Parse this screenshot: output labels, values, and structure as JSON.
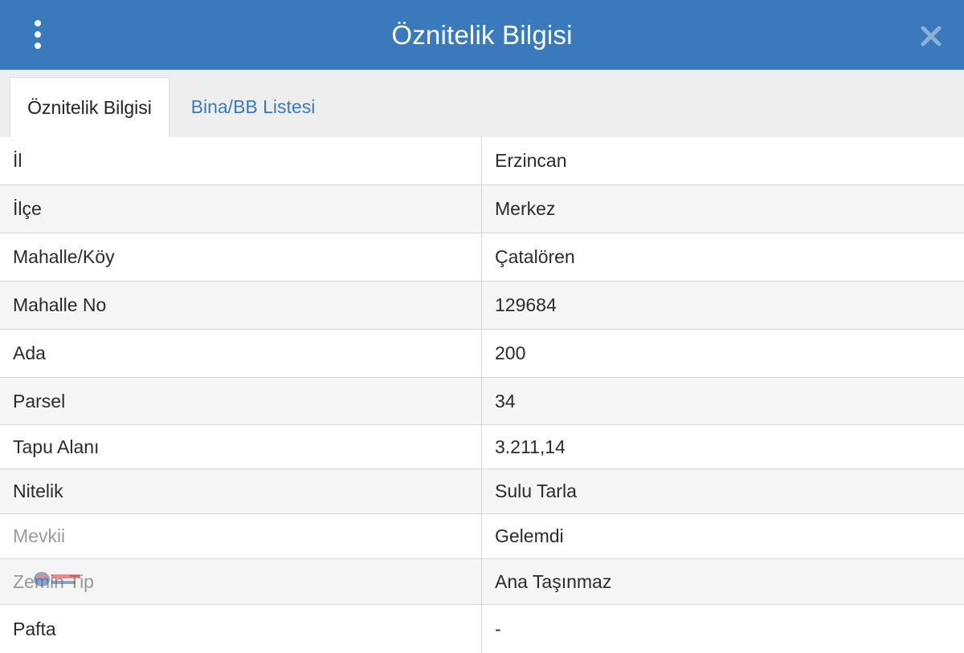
{
  "header": {
    "title": "Öznitelik Bilgisi"
  },
  "tabs": [
    {
      "label": "Öznitelik Bilgisi",
      "active": true
    },
    {
      "label": "Bina/BB Listesi",
      "active": false
    }
  ],
  "rows": [
    {
      "label": "İl",
      "value": "Erzincan"
    },
    {
      "label": "İlçe",
      "value": "Merkez"
    },
    {
      "label": "Mahalle/Köy",
      "value": "Çatalören"
    },
    {
      "label": "Mahalle No",
      "value": "129684"
    },
    {
      "label": "Ada",
      "value": "200"
    },
    {
      "label": "Parsel",
      "value": "34"
    },
    {
      "label": "Tapu Alanı",
      "value": "3.211,14"
    },
    {
      "label": "Nitelik",
      "value": "Sulu Tarla"
    },
    {
      "label": "Mevkii",
      "value": "Gelemdi"
    },
    {
      "label": "Zemin Tip",
      "value": "Ana Taşınmaz"
    },
    {
      "label": "Pafta",
      "value": "-"
    }
  ],
  "colors": {
    "header_bg": "#3a79bb",
    "tab_link": "#3a7ab8",
    "row_alt": "#f5f5f5"
  },
  "icons": {
    "menu": "vertical-dots-icon",
    "close": "close-icon"
  }
}
